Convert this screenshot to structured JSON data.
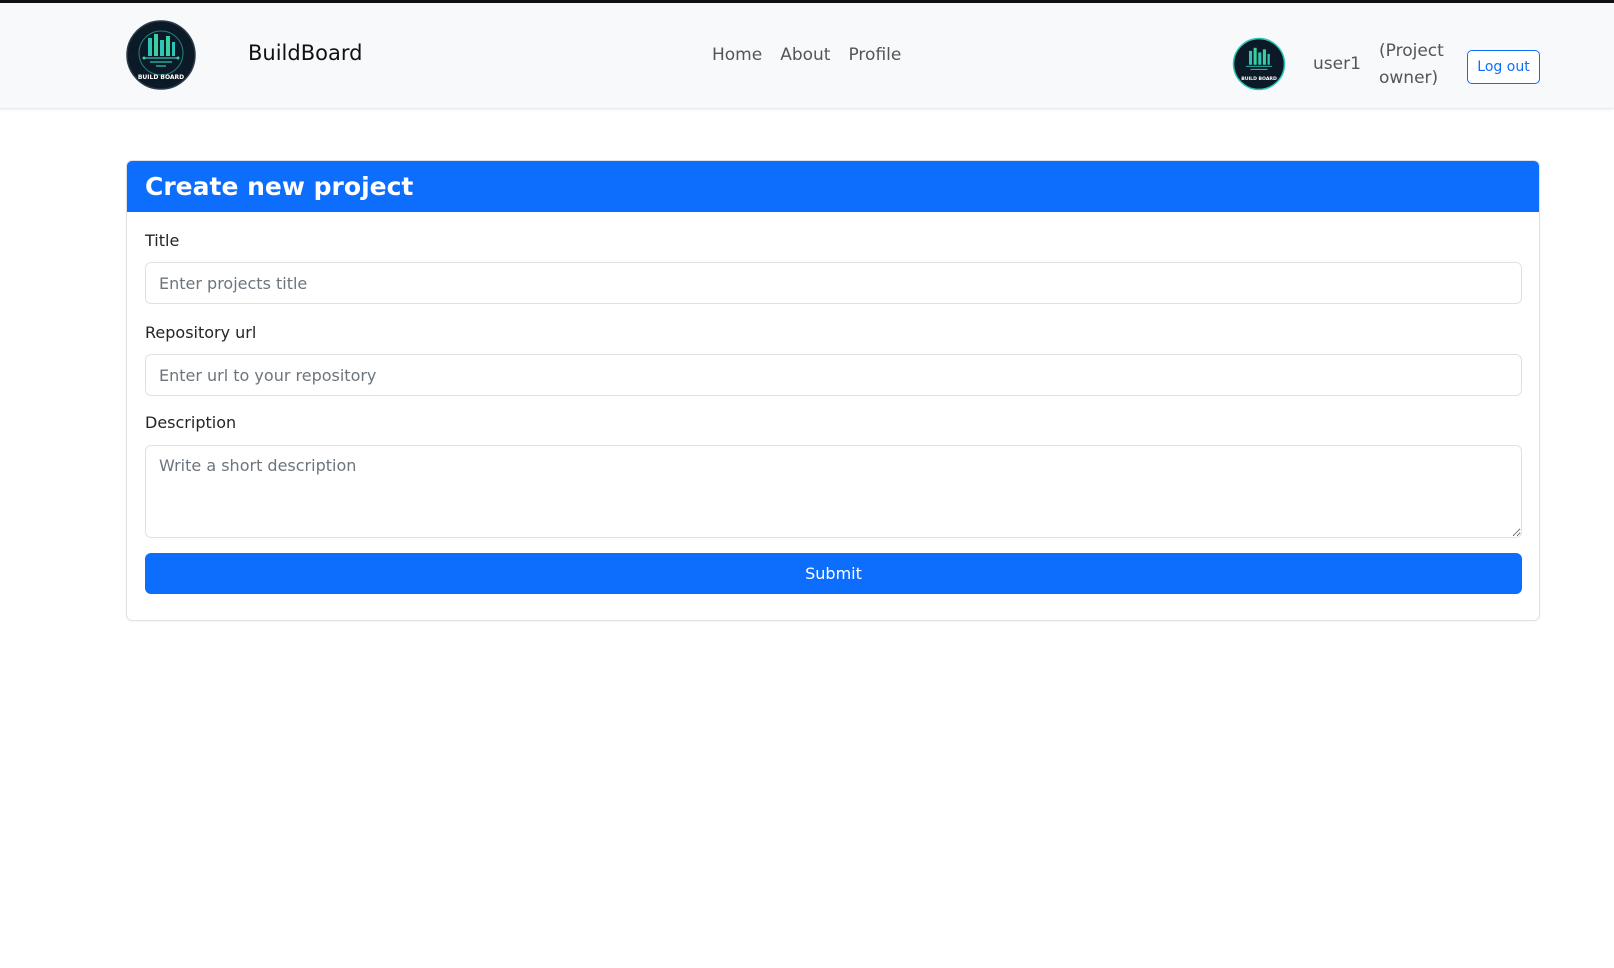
{
  "app": {
    "brand": "BuildBoard",
    "logo_text": "BUILD BOARD"
  },
  "nav": {
    "links": [
      {
        "label": "Home"
      },
      {
        "label": "About"
      },
      {
        "label": "Profile"
      }
    ]
  },
  "user": {
    "name": "user1",
    "role": "(Project owner)",
    "logout_label": "Log out"
  },
  "form": {
    "heading": "Create new project",
    "title_label": "Title",
    "title_placeholder": "Enter projects title",
    "title_value": "",
    "repo_label": "Repository url",
    "repo_placeholder": "Enter url to your repository",
    "repo_value": "",
    "description_label": "Description",
    "description_placeholder": "Write a short description",
    "description_value": "",
    "submit_label": "Submit"
  },
  "colors": {
    "primary": "#0d6efd",
    "navbar_bg": "#f8f9fa",
    "logo_bg": "#0b1a26",
    "logo_accent": "#2ec4b6"
  }
}
